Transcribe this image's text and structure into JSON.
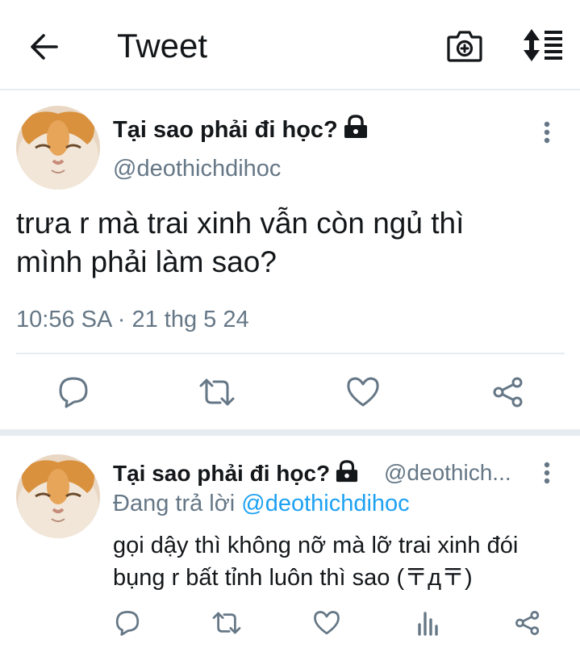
{
  "header": {
    "title": "Tweet",
    "back_icon": "arrow-left-icon",
    "camera_icon": "camera-add-icon",
    "sort_icon": "sort-list-icon"
  },
  "main_tweet": {
    "author_name": "Tại sao phải đi học?",
    "handle": "@deothichdihoc",
    "text_line1": "trưa r mà trai xinh vẫn còn ngủ thì",
    "text_line2": "mình phải làm sao?",
    "timestamp": "10:56 SA · 21 thg 5 24",
    "actions": [
      "reply-icon",
      "retweet-icon",
      "like-icon",
      "share-icon"
    ]
  },
  "reply_tweet": {
    "author_name": "Tại sao phải đi học?",
    "handle": "@deothich...",
    "replying_label": "Đang trả lời",
    "replying_to": "@deothichdihoc",
    "text_line1": "gọi dậy thì không nỡ mà lỡ trai xinh đói",
    "text_line2": "bụng r bất tỉnh luôn thì sao (〒д〒)",
    "actions": [
      "reply-icon",
      "retweet-icon",
      "like-icon",
      "analytics-icon",
      "share-icon"
    ]
  },
  "colors": {
    "text": "#14171a",
    "secondary": "#657786",
    "link": "#1da1f2",
    "divider": "#e6ecf0"
  }
}
